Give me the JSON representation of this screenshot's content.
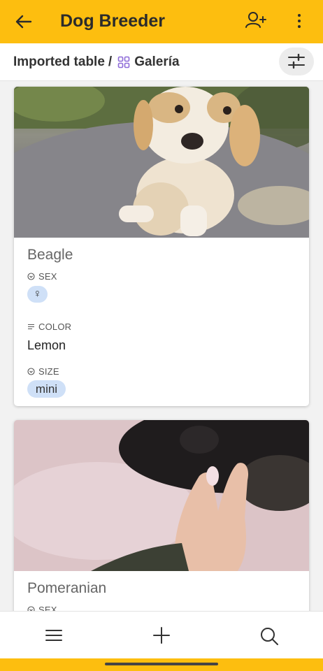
{
  "app": {
    "title": "Dog Breeder"
  },
  "breadcrumb": {
    "parent": "Imported table",
    "separator": "/",
    "current": "Galería"
  },
  "cards": [
    {
      "name": "Beagle",
      "sex_label": "SEX",
      "sex_value": "♀",
      "color_label": "COLOR",
      "color_value": "Lemon",
      "size_label": "SIZE",
      "size_value": "mini"
    },
    {
      "name": "Pomeranian",
      "sex_label": "SEX"
    }
  ],
  "icons": {
    "back": "arrow-left-icon",
    "add_user": "add-user-icon",
    "more": "more-vertical-icon",
    "filter": "sliders-icon",
    "gallery": "grid-icon",
    "menu": "hamburger-icon",
    "add": "plus-icon",
    "search": "search-icon"
  },
  "colors": {
    "accent": "#FDBE0F",
    "chip": "#cfe0f7",
    "gallery_icon": "#8e6bd8"
  }
}
